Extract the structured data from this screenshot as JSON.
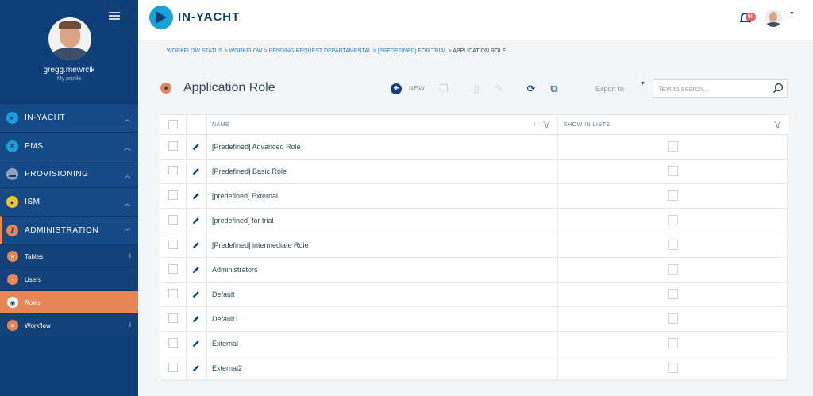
{
  "sidebar": {
    "username": "gregg.mewrcik",
    "profile_link": "My profile",
    "main_items": [
      {
        "label": "IN-YACHT",
        "icon": "in-yacht-icon",
        "color": "#16a2d6"
      },
      {
        "label": "PMS",
        "icon": "wrench-icon",
        "color": "#16a2d6"
      },
      {
        "label": "PROVISIONING",
        "icon": "basket-icon",
        "color": "#8fa3b8"
      },
      {
        "label": "ISM",
        "icon": "people-icon",
        "color": "#f2c230"
      },
      {
        "label": "ADMINISTRATION",
        "icon": "key-icon",
        "color": "#e88655"
      }
    ],
    "sub_items": [
      {
        "label": "Tables",
        "icon": "list-icon"
      },
      {
        "label": "Users",
        "icon": "lock-icon"
      },
      {
        "label": "Roles",
        "icon": "shield-icon"
      },
      {
        "label": "Workflow",
        "icon": "list-icon"
      }
    ]
  },
  "topbar": {
    "brand": "IN-YACHT",
    "notification_count": "80"
  },
  "breadcrumb": {
    "items": [
      "WORKFLOW STATUS",
      "WORKFLOW",
      "PENDING REQUEST DEPARTAMENTAL",
      "[PREDEFINED] FOR TRIAL"
    ],
    "separator": ">",
    "current": "APPLICATION ROLE"
  },
  "page": {
    "title": "Application Role",
    "new_label": "NEW",
    "export_label": "Export to",
    "search_placeholder": "Text to search..."
  },
  "table": {
    "columns": [
      "NAME",
      "SHOW IN LISTS"
    ],
    "rows": [
      "[Predefined] Advanced Role",
      "[Predefined] Basic Role",
      "[predefined] External",
      "[predefined] for trial",
      "[Predefined] intermediate Role",
      "Administrators",
      "Default",
      "Default1",
      "External",
      "External2"
    ]
  },
  "colors": {
    "sidebar": "#0f3f78",
    "accent": "#e88655",
    "brand": "#16a2d6"
  }
}
